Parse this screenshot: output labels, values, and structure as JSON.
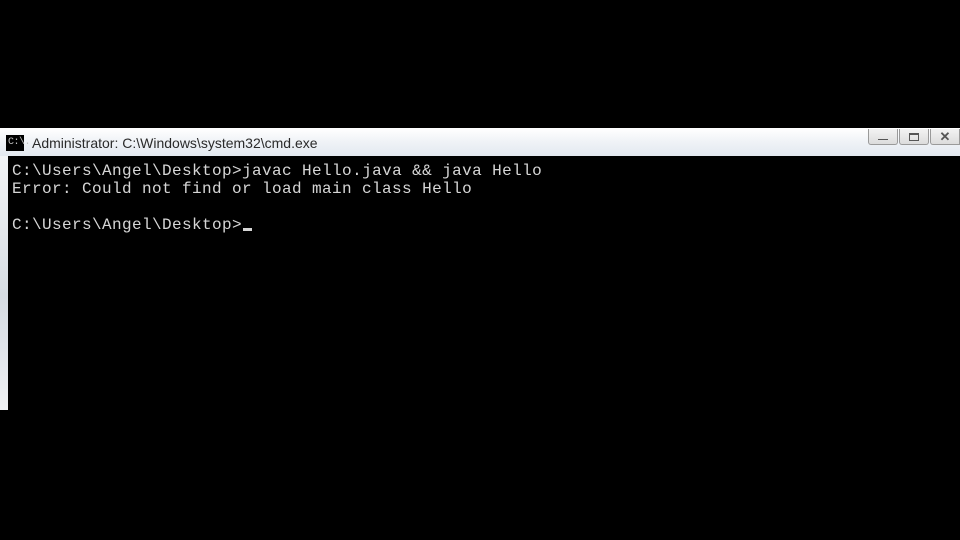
{
  "titlebar": {
    "icon_text": "C:\\.",
    "title": "Administrator: C:\\Windows\\system32\\cmd.exe"
  },
  "window_controls": {
    "minimize": "—",
    "maximize": "",
    "close": "✕"
  },
  "console": {
    "line1_prompt": "C:\\Users\\Angel\\Desktop>",
    "line1_cmd": "javac Hello.java && java Hello",
    "line2_error": "Error: Could not find or load main class Hello",
    "blank": "",
    "line3_prompt": "C:\\Users\\Angel\\Desktop>"
  }
}
